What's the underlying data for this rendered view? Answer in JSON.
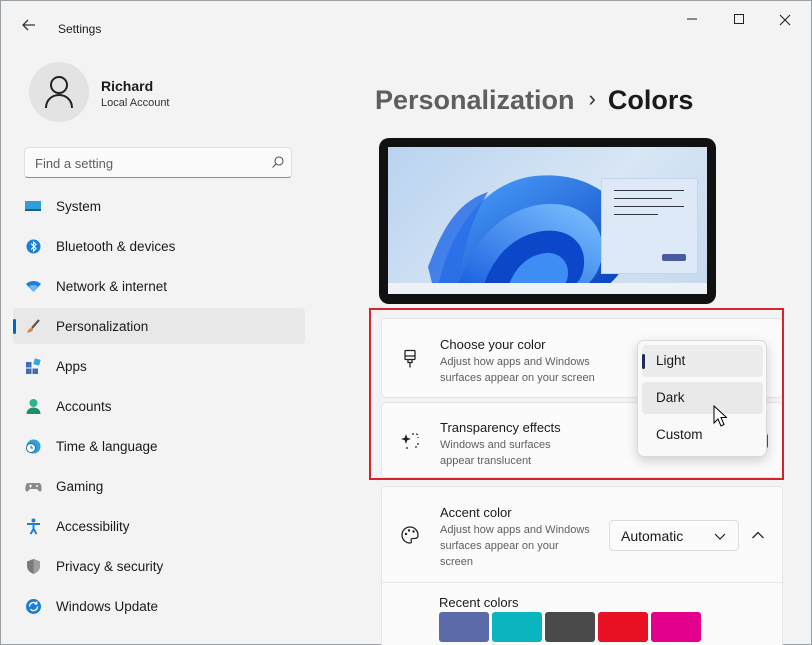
{
  "app": {
    "title": "Settings"
  },
  "user": {
    "name": "Richard",
    "account_type": "Local Account"
  },
  "search": {
    "placeholder": "Find a setting"
  },
  "nav": {
    "items": [
      {
        "label": "System",
        "icon": "display-icon"
      },
      {
        "label": "Bluetooth & devices",
        "icon": "bluetooth-icon"
      },
      {
        "label": "Network & internet",
        "icon": "wifi-icon"
      },
      {
        "label": "Personalization",
        "icon": "brush-icon",
        "selected": true
      },
      {
        "label": "Apps",
        "icon": "apps-icon"
      },
      {
        "label": "Accounts",
        "icon": "person-icon"
      },
      {
        "label": "Time & language",
        "icon": "globe-clock-icon"
      },
      {
        "label": "Gaming",
        "icon": "gamepad-icon"
      },
      {
        "label": "Accessibility",
        "icon": "accessibility-icon"
      },
      {
        "label": "Privacy & security",
        "icon": "shield-icon"
      },
      {
        "label": "Windows Update",
        "icon": "update-icon"
      }
    ]
  },
  "header": {
    "parent": "Personalization",
    "separator": "›",
    "current": "Colors"
  },
  "cards": {
    "choose_color": {
      "title": "Choose your color",
      "desc": "Adjust how apps and Windows surfaces appear on your screen"
    },
    "transparency": {
      "title": "Transparency effects",
      "desc": "Windows and surfaces appear translucent"
    },
    "accent": {
      "title": "Accent color",
      "desc": "Adjust how apps and Windows surfaces appear on your screen",
      "value": "Automatic"
    }
  },
  "color_mode_menu": {
    "options": [
      "Light",
      "Dark",
      "Custom"
    ],
    "selected": "Light",
    "hovered": "Dark"
  },
  "recent_colors": {
    "title": "Recent colors",
    "swatches": [
      "#5b6aa8",
      "#0bb5c0",
      "#4a4a4a",
      "#e81123",
      "#e3008c"
    ]
  },
  "colors": {
    "accent": "#0067c0",
    "highlight_border": "#d9232b"
  }
}
